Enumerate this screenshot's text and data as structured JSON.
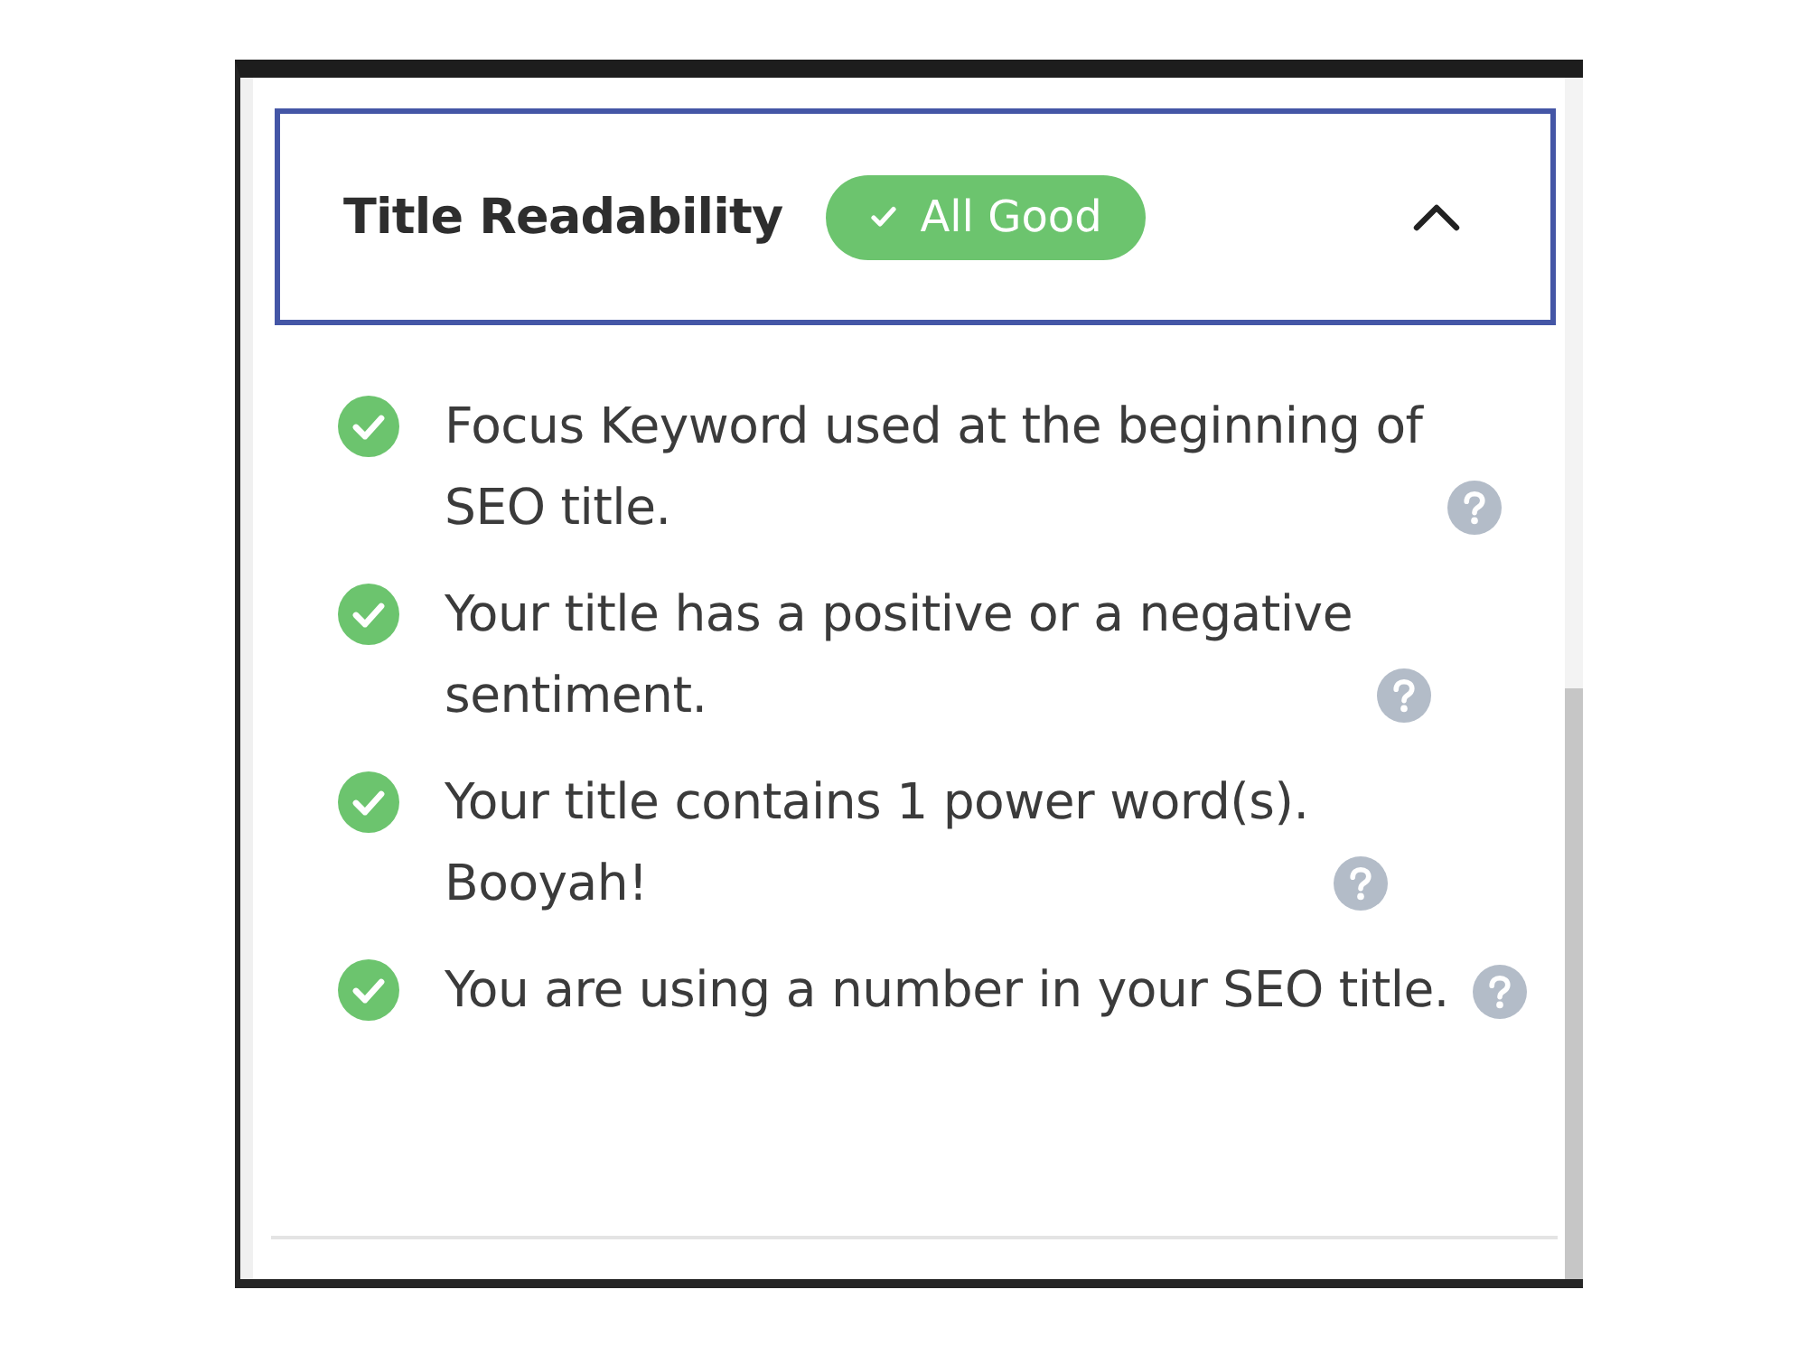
{
  "panel": {
    "title": "Title Readability",
    "status_badge": {
      "label": "All Good"
    },
    "expanded": true,
    "checks": [
      {
        "text": "Focus Keyword used at the beginning of SEO title.",
        "passed": true
      },
      {
        "text": "Your title has a positive or a negative sentiment.",
        "passed": true
      },
      {
        "text": "Your title contains 1 power word(s). Booyah!",
        "passed": true
      },
      {
        "text": "You are using a number in your SEO title.",
        "passed": true
      }
    ]
  }
}
